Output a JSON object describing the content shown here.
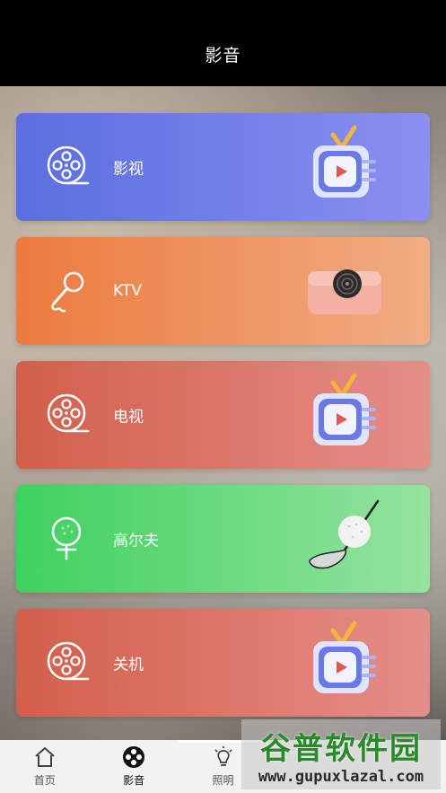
{
  "header": {
    "title": "影音"
  },
  "cards": [
    {
      "label": "影视",
      "icon": "film-reel-icon",
      "illustration": "tv-illustration"
    },
    {
      "label": "KTV",
      "icon": "microphone-icon",
      "illustration": "speaker-illustration"
    },
    {
      "label": "电视",
      "icon": "film-reel-icon",
      "illustration": "tv-illustration"
    },
    {
      "label": "高尔夫",
      "icon": "golf-ball-icon",
      "illustration": "golf-club-illustration"
    },
    {
      "label": "关机",
      "icon": "film-reel-icon",
      "illustration": "tv-illustration"
    }
  ],
  "tabs": [
    {
      "label": "首页",
      "icon": "home-icon"
    },
    {
      "label": "影音",
      "icon": "media-reel-icon",
      "active": true
    },
    {
      "label": "照明",
      "icon": "lightbulb-icon"
    },
    {
      "label": "",
      "icon": "hidden-tab-icon"
    },
    {
      "label": "",
      "icon": "hidden-tab-icon"
    }
  ],
  "watermark": {
    "title": "谷普软件园",
    "url": "www.gupuxlazal.com"
  },
  "colors": {
    "card1": "#5a6fe0",
    "card2": "#ec7a3e",
    "card3": "#d35f4b",
    "card4": "#3fd15e",
    "card5": "#d35f4b"
  }
}
